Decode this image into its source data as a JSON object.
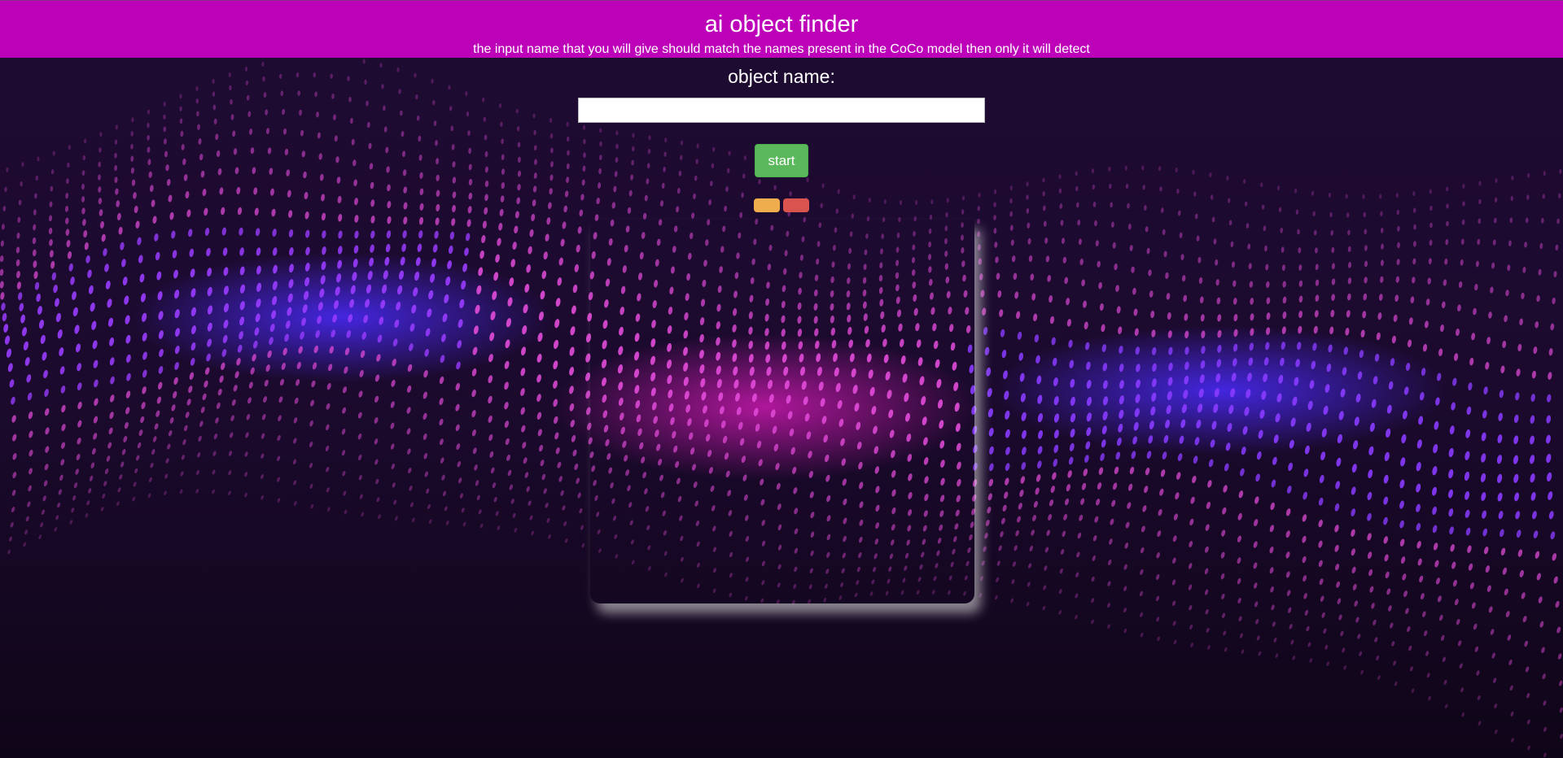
{
  "header": {
    "title": "ai object finder",
    "subtitle": "the input name that you will give should match the names present in the CoCo model then only it will detect"
  },
  "form": {
    "label": "object name:",
    "input_value": "",
    "start_label": "start"
  },
  "colors": {
    "header_bg": "#bc01b8",
    "start_button": "#5cb85c",
    "warning_button": "#f0ad4e",
    "danger_button": "#d9534f",
    "page_bg": "#1a0a2b"
  }
}
